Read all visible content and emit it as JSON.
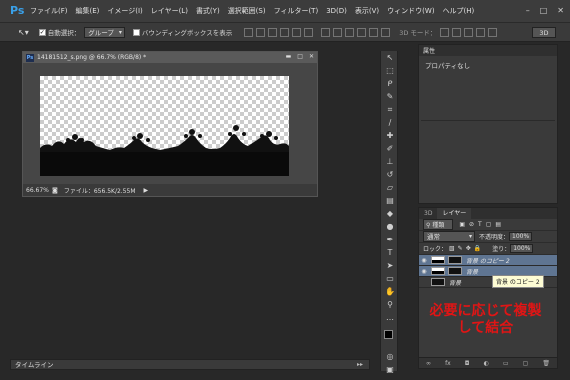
{
  "menubar": {
    "logo": "Ps",
    "items": [
      "ファイル(F)",
      "編集(E)",
      "イメージ(I)",
      "レイヤー(L)",
      "書式(Y)",
      "選択範囲(S)",
      "フィルター(T)",
      "3D(D)",
      "表示(V)",
      "ウィンドウ(W)",
      "ヘルプ(H)"
    ],
    "window_controls": [
      "–",
      "□",
      "✕"
    ]
  },
  "options": {
    "auto_select_label": "自動選択：",
    "auto_select_value": "グループ",
    "bbox_label": "バウンディングボックスを表示",
    "mode_3d": "3D モード：",
    "workspace": "3D"
  },
  "document": {
    "title": "14181512_s.png @ 66.7% (RGB/8) *",
    "badge": "Ps",
    "zoom": "66.67%",
    "file_info": "ファイル：656.5K/2.55M"
  },
  "properties": {
    "tab": "属性",
    "content": "プロパティなし"
  },
  "layers_panel": {
    "tabs": [
      "3D",
      "レイヤー"
    ],
    "kind_label": "種類",
    "blend_mode": "通常",
    "opacity_label": "不透明度：",
    "opacity_value": "100%",
    "lock_label": "ロック：",
    "fill_label": "塗り：",
    "fill_value": "100%",
    "layers": [
      {
        "name": "背景 のコピー 2",
        "selected": true
      },
      {
        "name": "背景",
        "selected": false
      },
      {
        "name": "背景",
        "selected": false
      }
    ],
    "tooltip": "背景 のコピー 2"
  },
  "annotation": {
    "line1": "必要に応じて複製",
    "line2": "して結合"
  },
  "timeline": {
    "label": "タイムライン"
  },
  "colors": {
    "accent": "#5f7592",
    "annotation": "#e01515"
  }
}
